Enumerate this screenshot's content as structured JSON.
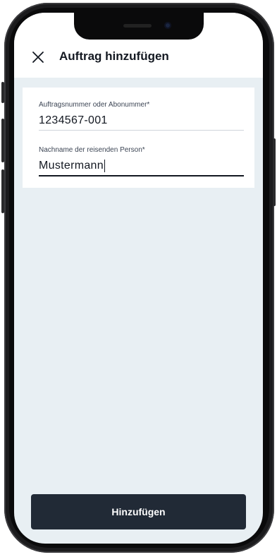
{
  "header": {
    "title": "Auftrag hinzufügen",
    "close_icon": "close-icon"
  },
  "form": {
    "order_number": {
      "label": "Auftragsnummer oder Abonummer*",
      "value": "1234567-001"
    },
    "last_name": {
      "label": "Nachname der reisenden Person*",
      "value": "Mustermann"
    }
  },
  "actions": {
    "submit_label": "Hinzufügen"
  },
  "colors": {
    "primary": "#212a36",
    "background": "#e8eff3",
    "text": "#131821"
  }
}
